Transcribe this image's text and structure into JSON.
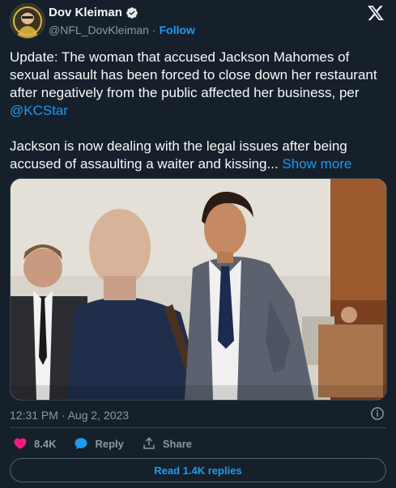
{
  "author": {
    "name": "Dov Kleiman",
    "handle": "@NFL_DovKleiman",
    "separator": "·",
    "follow_label": "Follow",
    "verified_icon": "verified-badge-icon"
  },
  "tweet": {
    "text_part1": "Update: The woman that accused Jackson Mahomes of sexual assault has been forced to close down her restaurant after negatively from the public affected her business, per ",
    "mention": "@KCStar",
    "text_part2": "\n\nJackson is now dealing with the legal issues after being accused of assaulting a waiter and kissing... ",
    "show_more": "Show more",
    "timestamp": "12:31 PM · Aug 2, 2023"
  },
  "actions": {
    "likes": "8.4K",
    "reply_label": "Reply",
    "share_label": "Share"
  },
  "replies_button": "Read 1.4K replies",
  "colors": {
    "background": "#15202b",
    "accent": "#1d9bf0",
    "like": "#f91880",
    "muted": "#8b98a5"
  }
}
